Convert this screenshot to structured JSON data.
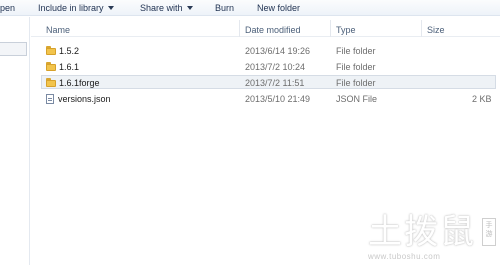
{
  "toolbar": {
    "open_label": "pen",
    "include_label": "Include in library",
    "share_label": "Share with",
    "burn_label": "Burn",
    "new_folder_label": "New folder"
  },
  "columns": {
    "name": "Name",
    "date": "Date modified",
    "type": "Type",
    "size": "Size"
  },
  "files": [
    {
      "name": "1.5.2",
      "date": "2013/6/14 19:26",
      "type": "File folder",
      "size": "",
      "icon": "folder-icon"
    },
    {
      "name": "1.6.1",
      "date": "2013/7/2 10:24",
      "type": "File folder",
      "size": "",
      "icon": "folder-icon"
    },
    {
      "name": "1.6.1forge",
      "date": "2013/7/2 11:51",
      "type": "File folder",
      "size": "",
      "icon": "folder-icon",
      "selected": true
    },
    {
      "name": "versions.json",
      "date": "2013/5/10 21:49",
      "type": "JSON File",
      "size": "2 KB",
      "icon": "file-icon"
    }
  ],
  "watermark": {
    "big_text": "土拨鼠",
    "small_text": "www.tuboshu.com",
    "tag_text": "手游"
  }
}
